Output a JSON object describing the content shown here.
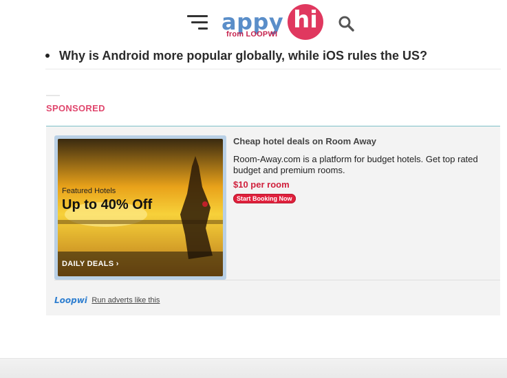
{
  "header": {
    "logo_main": "appy",
    "logo_sub": "from LOOPWI",
    "logo_badge": "hi"
  },
  "related": {
    "items": [
      {
        "label": "Why is Android more popular globally, while iOS rules the US?"
      }
    ]
  },
  "sponsored": {
    "label": "SPONSORED",
    "ad": {
      "image_small": "Featured Hotels",
      "image_offer": "Up to 40% Off",
      "image_deals": "DAILY DEALS ›",
      "title": "Cheap hotel deals on Room Away",
      "description": "Room-Away.com is a platform for budget hotels. Get top rated budget and premium rooms.",
      "price": "$10 per room",
      "cta": "Start Booking Now"
    },
    "footer": {
      "network": "Loopwi",
      "run_adverts": "Run adverts like this"
    }
  },
  "colors": {
    "accent": "#e0466d",
    "logo_blue": "#5a8ec9",
    "logo_pink": "#e0385f",
    "price_red": "#d0203c"
  }
}
